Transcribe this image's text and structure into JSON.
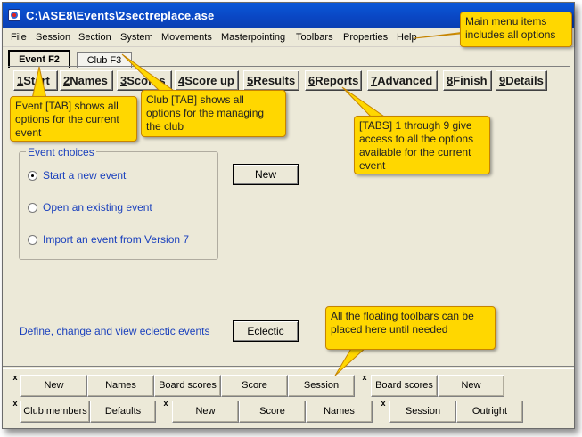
{
  "window": {
    "title": "C:\\ASE8\\Events\\2sectreplace.ase"
  },
  "menu": [
    "File",
    "Session",
    "Section",
    "System",
    "Movements",
    "Masterpointing",
    "Toolbars",
    "Properties",
    "Help"
  ],
  "tabs": {
    "event": "Event F2",
    "club": "Club F3"
  },
  "action_tabs": [
    {
      "num": "1",
      "label": "Start"
    },
    {
      "num": "2",
      "label": "Names"
    },
    {
      "num": "3",
      "label": "Scores"
    },
    {
      "num": "4",
      "label": "Score up"
    },
    {
      "num": "5",
      "label": "Results"
    },
    {
      "num": "6",
      "label": "Reports"
    },
    {
      "num": "7",
      "label": "Advanced"
    },
    {
      "num": "8",
      "label": "Finish"
    },
    {
      "num": "9",
      "label": "Details"
    }
  ],
  "event_choices": {
    "title": "Event choices",
    "options": [
      "Start a new event",
      "Open an existing event",
      "Import an event from Version 7"
    ],
    "selected": "Start a new event"
  },
  "buttons": {
    "new": "New",
    "eclectic": "Eclectic"
  },
  "eclectic_text": "Define, change and view eclectic events",
  "toolbar_row1": {
    "group1": [
      "New",
      "Names",
      "Board scores",
      "Score",
      "Session"
    ],
    "group2": [
      "Board scores",
      "New"
    ]
  },
  "toolbar_row2": {
    "group1": [
      "Club members",
      "Defaults"
    ],
    "group2": [
      "New",
      "Score",
      "Names"
    ],
    "group3": [
      "Session",
      "Outright"
    ]
  },
  "toolbar_close_glyph": "x",
  "callouts": {
    "menu": "Main menu items includes all options",
    "event_tab": "Event [TAB] shows all options for the current event",
    "club_tab": "Club [TAB] shows all options for the managing the club",
    "tabs_1_9": "[TABS] 1 through 9 give access to all the options available for the current event",
    "toolbars": "All the floating toolbars can be placed here until needed"
  },
  "colors": {
    "titlebar": "#0a47c4",
    "window_bg": "#ece9d8",
    "callout_bg": "#ffd700",
    "label_blue": "#1b41bd"
  }
}
